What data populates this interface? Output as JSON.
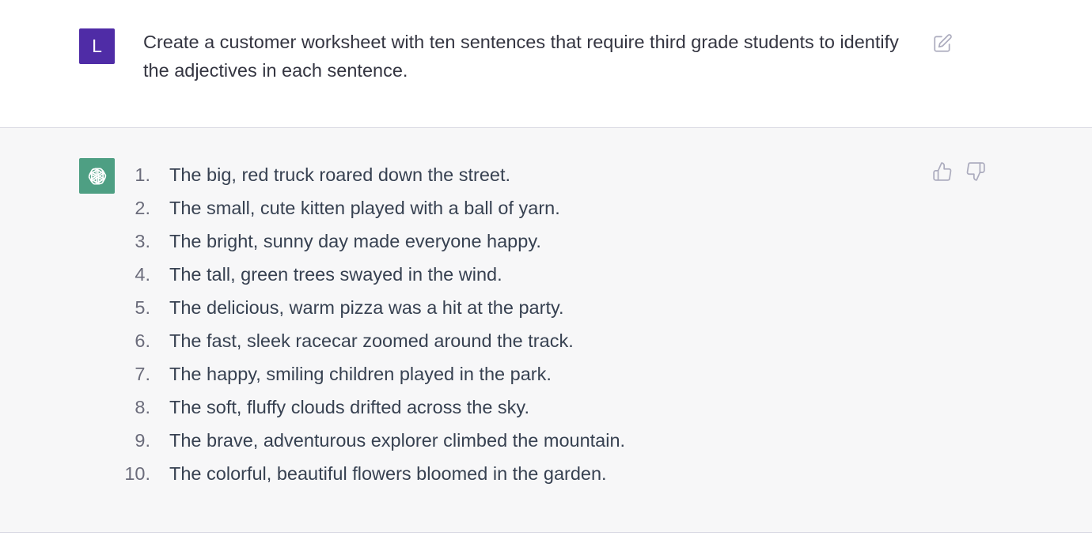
{
  "user_message": {
    "avatar_letter": "L",
    "avatar_color": "#4f2ca6",
    "text": "Create a customer worksheet with ten sentences that require third grade students to identify the adjectives in each sentence.",
    "edit_icon": "edit-icon"
  },
  "assistant_message": {
    "avatar_icon": "openai-logo-icon",
    "avatar_color": "#4e9f83",
    "items": [
      {
        "num": "1.",
        "text": "The big, red truck roared down the street."
      },
      {
        "num": "2.",
        "text": "The small, cute kitten played with a ball of yarn."
      },
      {
        "num": "3.",
        "text": "The bright, sunny day made everyone happy."
      },
      {
        "num": "4.",
        "text": "The tall, green trees swayed in the wind."
      },
      {
        "num": "5.",
        "text": "The delicious, warm pizza was a hit at the party."
      },
      {
        "num": "6.",
        "text": "The fast, sleek racecar zoomed around the track."
      },
      {
        "num": "7.",
        "text": "The happy, smiling children played in the park."
      },
      {
        "num": "8.",
        "text": "The soft, fluffy clouds drifted across the sky."
      },
      {
        "num": "9.",
        "text": "The brave, adventurous explorer climbed the mountain."
      },
      {
        "num": "10.",
        "text": "The colorful, beautiful flowers bloomed in the garden."
      }
    ],
    "feedback_icons": [
      "thumbs-up-icon",
      "thumbs-down-icon"
    ]
  }
}
